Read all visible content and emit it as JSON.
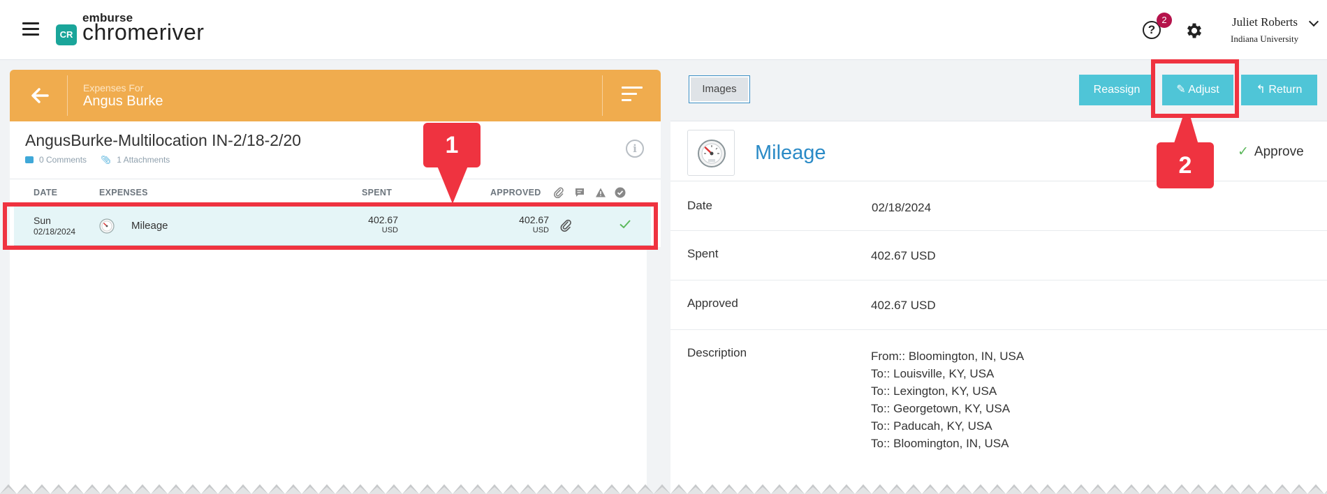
{
  "topbar": {
    "brand_small": "emburse",
    "brand_large": "chromeriver",
    "brand_mark": "CR",
    "help_badge_count": "2",
    "help_glyph": "?",
    "user_name": "Juliet Roberts",
    "user_org": "Indiana University"
  },
  "left": {
    "header_subtitle": "Expenses For",
    "header_name": "Angus Burke",
    "report_title": "AngusBurke-Multilocation IN-2/18-2/20",
    "comments": "0 Comments",
    "attachments": "1 Attachments",
    "columns": {
      "date": "DATE",
      "expenses": "EXPENSES",
      "spent": "SPENT",
      "approved": "APPROVED"
    },
    "rows": [
      {
        "day": "Sun",
        "date": "02/18/2024",
        "name": "Mileage",
        "spent": "402.67",
        "spent_currency": "USD",
        "approved": "402.67",
        "approved_currency": "USD"
      }
    ]
  },
  "right": {
    "images_label": "Images",
    "reassign_label": "Reassign",
    "adjust_label": "Adjust",
    "return_label": "Return",
    "expense_type": "Mileage",
    "approve_label": "Approve",
    "details": [
      {
        "label": "Date",
        "value": "02/18/2024"
      },
      {
        "label": "Spent",
        "value": "402.67 USD"
      },
      {
        "label": "Approved",
        "value": "402.67 USD"
      },
      {
        "label": "Description",
        "lines": [
          "From:: Bloomington, IN, USA",
          "To:: Louisville, KY, USA",
          "To:: Lexington, KY, USA",
          "To:: Georgetown, KY, USA",
          "To:: Paducah, KY, USA",
          "To:: Bloomington, IN, USA"
        ]
      }
    ]
  },
  "annotations": {
    "callout_1": "1",
    "callout_2": "2"
  },
  "colors": {
    "header_orange": "#f0ac4e",
    "button_teal": "#4fc5d7",
    "link_blue": "#2a8ac6",
    "annotation_red": "#ef3340",
    "badge_red": "#b5134b",
    "row_highlight": "#e5f5f7"
  },
  "icons": [
    "menu-icon",
    "help-icon",
    "gear-icon",
    "chevron-down-icon",
    "back-arrow-icon",
    "sort-icon",
    "info-icon",
    "comment-icon",
    "paperclip-icon",
    "warning-icon",
    "check-circle-icon",
    "speedometer-icon",
    "check-icon",
    "pencil-icon",
    "reply-icon"
  ]
}
